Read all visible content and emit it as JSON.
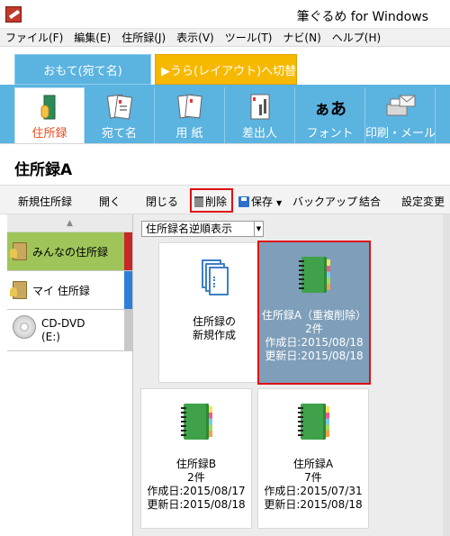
{
  "window": {
    "title": "筆ぐるめ for Windows"
  },
  "menu": [
    "ファイル(F)",
    "編集(E)",
    "住所録(J)",
    "表示(V)",
    "ツール(T)",
    "ナビ(N)",
    "ヘルプ(H)"
  ],
  "mode_tabs": {
    "front": "おもて(宛て名)",
    "back": "▶うら(レイアウト)へ切替"
  },
  "ribbon": [
    "住所録",
    "宛て名",
    "用 紙",
    "差出人",
    "フォント",
    "印刷・メール"
  ],
  "ribbon_font_glyph": "ぁあ",
  "page_title": "住所録A",
  "toolbar": {
    "new": "新規住所録",
    "open": "開く",
    "close": "閉じる",
    "delete": "削除",
    "save": "保存",
    "backup": "バックアップ",
    "merge": "結合",
    "settings": "設定変更"
  },
  "sidebar": {
    "up_arrow": "▲",
    "items": [
      {
        "label": "みんなの住所録",
        "bar_color": "#c62828"
      },
      {
        "label": "マイ 住所録",
        "bar_color": "#2f7fd8"
      },
      {
        "label": "CD-DVD",
        "label2": "(E:)",
        "bar_color": "#c8c8c8"
      }
    ]
  },
  "sort_select": {
    "value": "住所録名逆順表示"
  },
  "cards": [
    {
      "kind": "new",
      "lines": [
        "住所録の",
        "新規作成"
      ]
    },
    {
      "kind": "book",
      "selected": true,
      "lines": [
        "住所録A（重複削除）",
        "2件",
        "作成日:2015/08/18",
        "更新日:2015/08/18"
      ]
    },
    {
      "kind": "book",
      "selected": false,
      "lines": [
        "住所録B",
        "2件",
        "作成日:2015/08/17",
        "更新日:2015/08/18"
      ]
    },
    {
      "kind": "book",
      "selected": false,
      "lines": [
        "住所録A",
        "7件",
        "作成日:2015/07/31",
        "更新日:2015/08/18"
      ]
    }
  ],
  "colors": {
    "ribbon": "#5bb3e0",
    "back_tab": "#f7b800",
    "selected_sidebar": "#9fc55a",
    "selected_card": "#7e9eb9",
    "highlight_box": "#e01010"
  }
}
